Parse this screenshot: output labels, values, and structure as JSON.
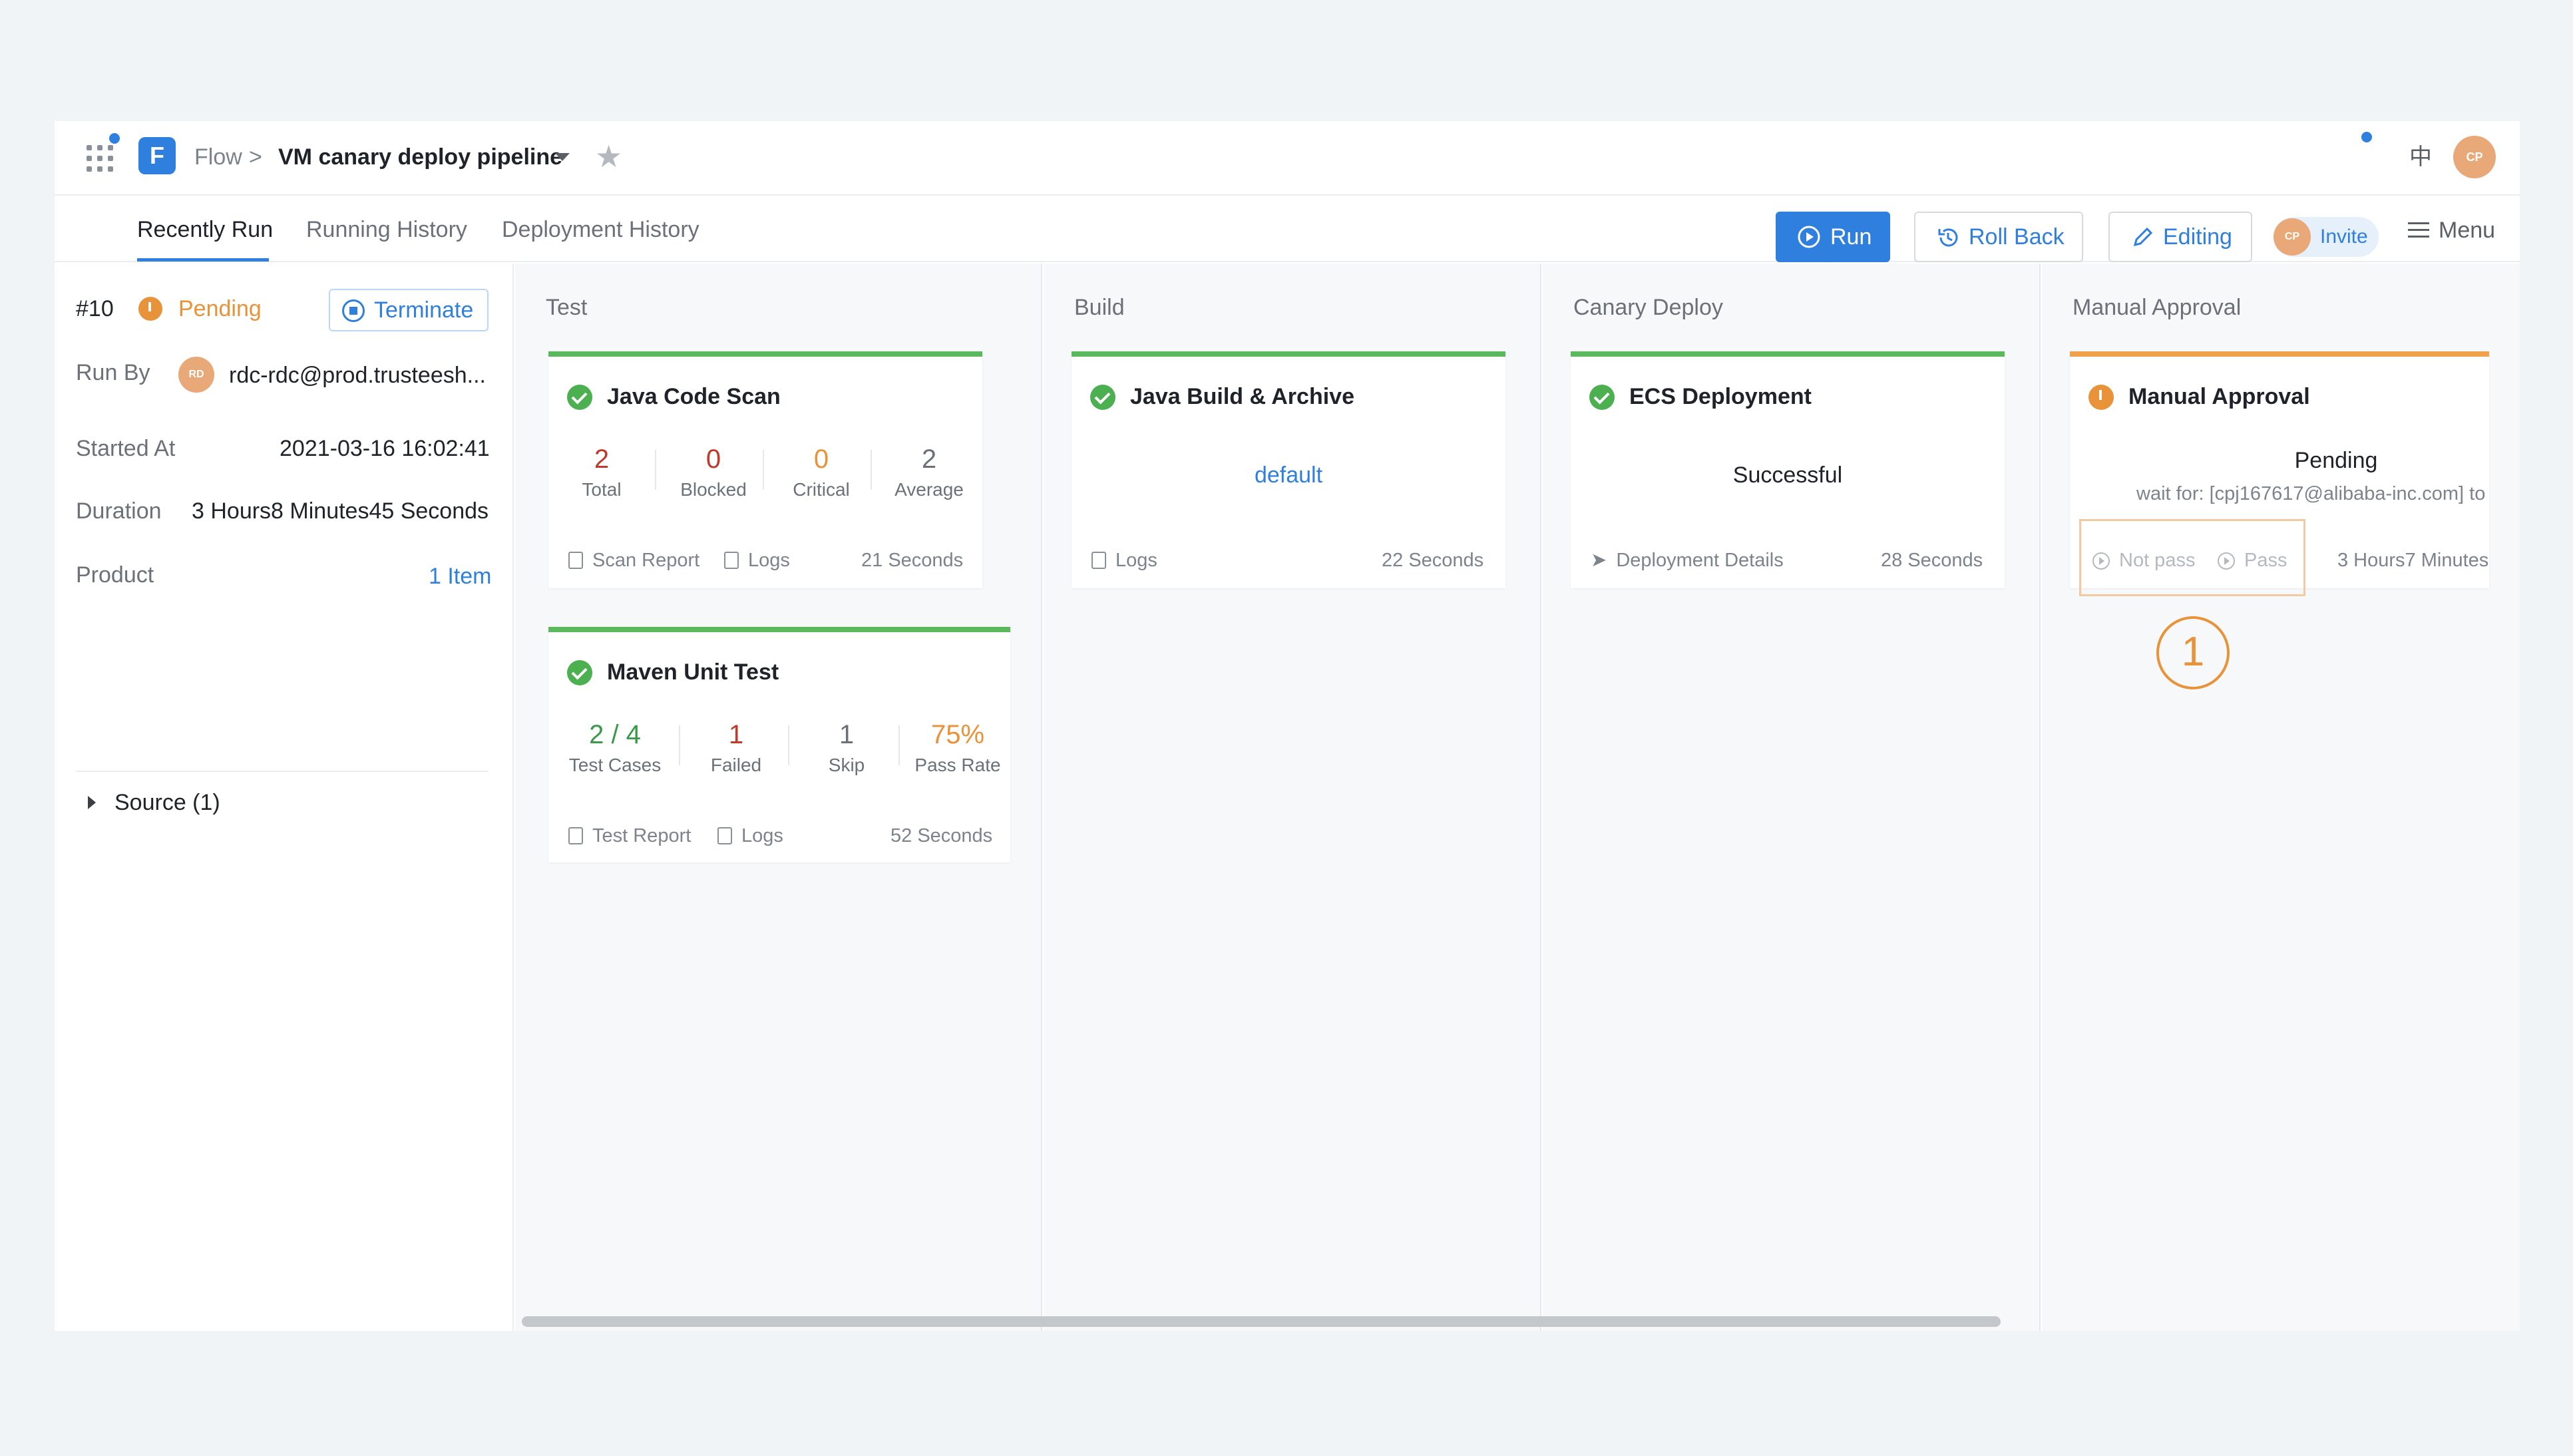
{
  "header": {
    "breadcrumb_root": "Flow",
    "breadcrumb_sep": ">",
    "pipeline_name": "VM canary deploy pipeline",
    "lang_toggle": "中",
    "user_initials": "CP"
  },
  "tabs": [
    "Recently Run",
    "Running History",
    "Deployment History"
  ],
  "actions": {
    "run": "Run",
    "rollback": "Roll Back",
    "editing": "Editing",
    "invite": "Invite",
    "invite_initials": "CP",
    "menu": "Menu"
  },
  "run_info": {
    "number": "#10",
    "status": "Pending",
    "terminate": "Terminate",
    "run_by_label": "Run By",
    "run_by_initials": "RD",
    "run_by_value": "rdc-rdc@prod.trusteesh...",
    "started_label": "Started At",
    "started_value": "2021-03-16 16:02:41",
    "duration_label": "Duration",
    "duration_value": "3 Hours8 Minutes45 Seconds",
    "product_label": "Product",
    "product_value": "1 Item",
    "source_label": "Source (1)"
  },
  "stages": [
    {
      "title": "Test",
      "jobs": [
        {
          "name": "Java Code Scan",
          "metrics": [
            {
              "value": "2",
              "label": "Total"
            },
            {
              "value": "0",
              "label": "Blocked"
            },
            {
              "value": "0",
              "label": "Critical"
            },
            {
              "value": "2",
              "label": "Average"
            }
          ],
          "links": [
            "Scan Report",
            "Logs"
          ],
          "duration": "21 Seconds"
        },
        {
          "name": "Maven Unit Test",
          "metrics": [
            {
              "value": "2 / 4",
              "label": "Test Cases"
            },
            {
              "value": "1",
              "label": "Failed"
            },
            {
              "value": "1",
              "label": "Skip"
            },
            {
              "value": "75%",
              "label": "Pass Rate"
            }
          ],
          "links": [
            "Test Report",
            "Logs"
          ],
          "duration": "52 Seconds"
        }
      ]
    },
    {
      "title": "Build",
      "jobs": [
        {
          "name": "Java Build & Archive",
          "center": "default",
          "links": [
            "Logs"
          ],
          "duration": "22 Seconds"
        }
      ]
    },
    {
      "title": "Canary Deploy",
      "jobs": [
        {
          "name": "ECS Deployment",
          "center": "Successful",
          "links": [
            "Deployment Details"
          ],
          "duration": "28 Seconds"
        }
      ]
    },
    {
      "title": "Manual Approval",
      "jobs": [
        {
          "name": "Manual Approval",
          "center": "Pending",
          "subtext": "wait for: [cpj167617@alibaba-inc.com] to",
          "links": [
            "Not pass",
            "Pass"
          ],
          "duration": "3 Hours7 Minutes"
        }
      ]
    }
  ],
  "annotation_number": "1",
  "colors": {
    "accent": "#2f7fdf",
    "success": "#4caf50",
    "pending": "#e8933a",
    "danger": "#c0392b"
  }
}
